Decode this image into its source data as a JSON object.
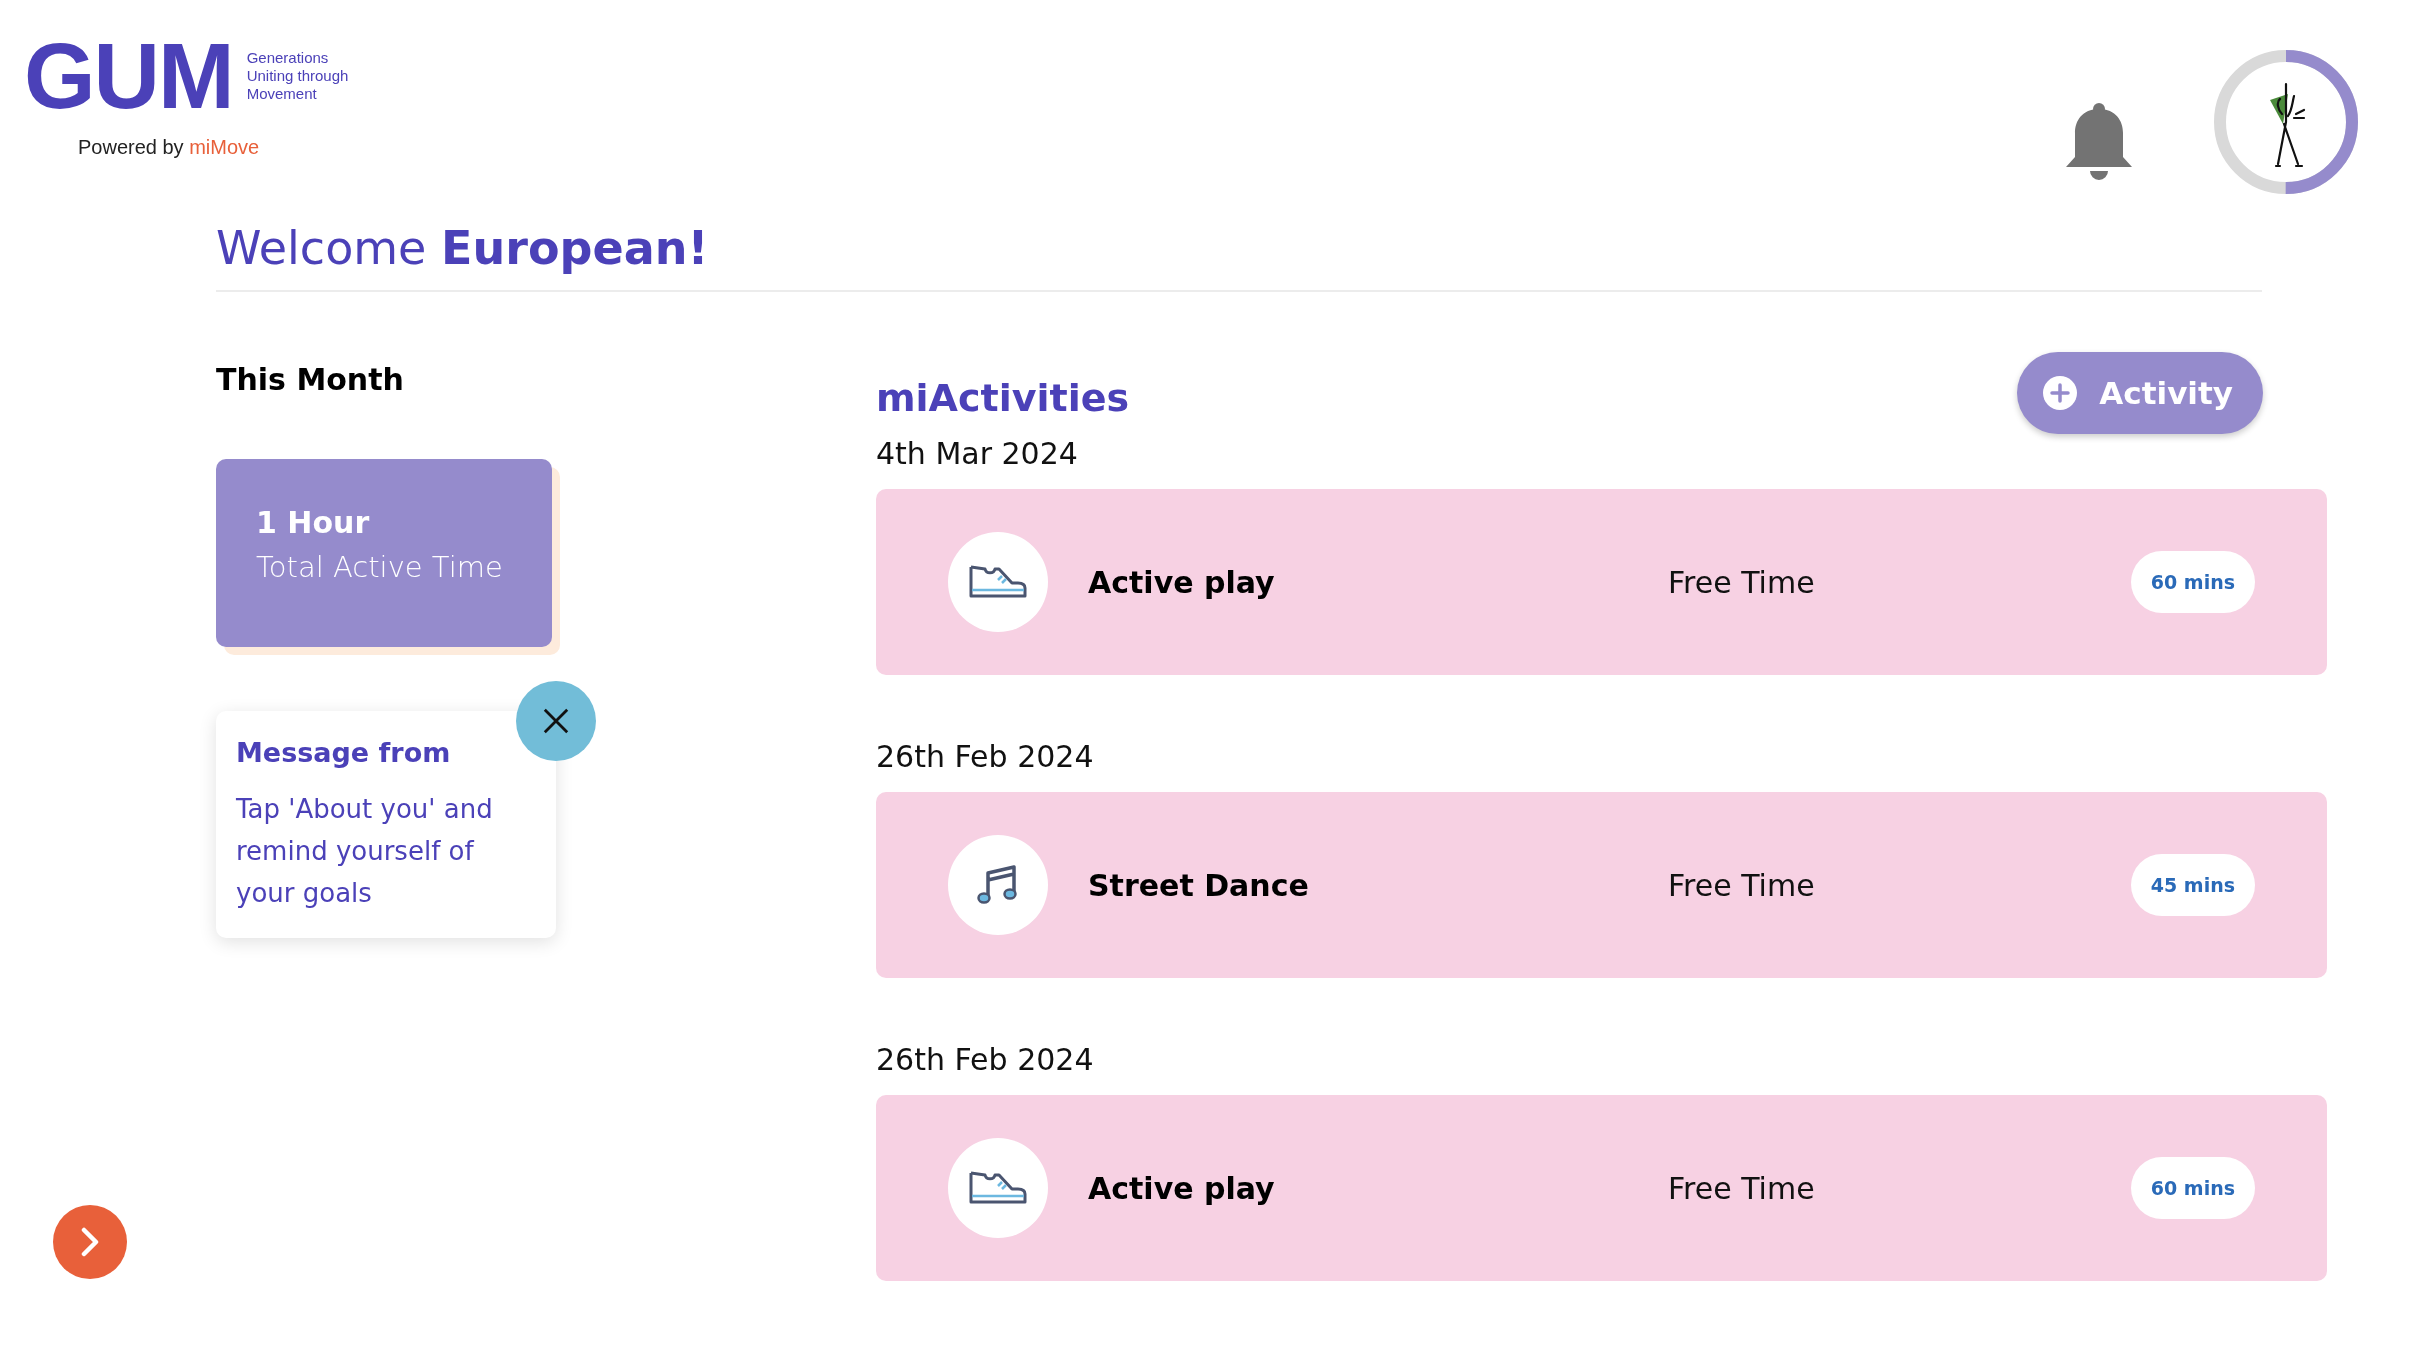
{
  "logo": {
    "wordmark": "GUM",
    "tagline": [
      "Generations",
      "Uniting through",
      "Movement"
    ],
    "powered_by": "Powered by",
    "brand": "miMove"
  },
  "profile": {
    "progress": {
      "level": 0.5
    }
  },
  "welcome": "Welcome **European!**",
  "summary": {
    "heading": "This Month",
    "value": "1 Hour",
    "label": "Total Active Time"
  },
  "message": {
    "title": "Message from",
    "body": "Tap 'About you' and remind yourself of your goals"
  },
  "activities": {
    "heading": "miActivities",
    "add_button": "Activity",
    "entries": [
      {
        "date": "4th Mar 2024",
        "kind": "shoe",
        "name": "Active play",
        "category": "Free Time",
        "duration": "60 mins"
      },
      {
        "date": "26th Feb 2024",
        "kind": "music",
        "name": "Street Dance",
        "category": "Free Time",
        "duration": "45 mins"
      },
      {
        "date": "26th Feb 2024",
        "kind": "shoe",
        "name": "Active play",
        "category": "Free Time",
        "duration": "60 mins"
      }
    ]
  }
}
